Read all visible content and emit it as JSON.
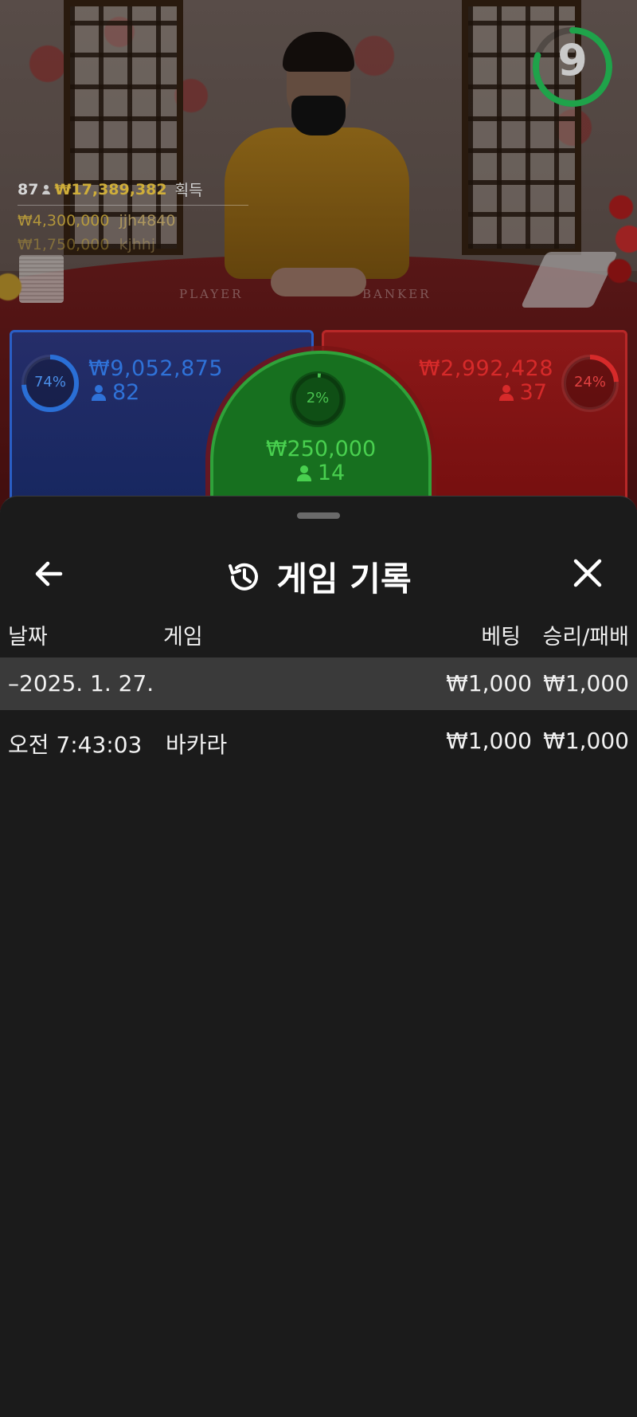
{
  "colors": {
    "player": "#2a6fd6",
    "banker": "#d62a2a",
    "tie": "#49c24f",
    "gold": "#cfae3a",
    "sheet_bg": "#1b1b1b",
    "row_highlight": "#3a3a3a"
  },
  "video": {
    "felt_player": "PLAYER",
    "felt_banker": "BANKER"
  },
  "timer": {
    "value": "9",
    "progress": 0.8
  },
  "winners": {
    "count": "87",
    "total": "₩17,389,382",
    "earned_label": "획득",
    "list": [
      {
        "amount": "₩4,300,000",
        "name": "jjh4840"
      },
      {
        "amount": "₩1,750,000",
        "name": "kjhhj"
      }
    ]
  },
  "bets": {
    "player": {
      "percent": 74,
      "percent_label": "74%",
      "amount": "₩9,052,875",
      "count": "82"
    },
    "tie": {
      "percent": 2,
      "percent_label": "2%",
      "amount": "₩250,000",
      "count": "14"
    },
    "banker": {
      "percent": 24,
      "percent_label": "24%",
      "amount": "₩2,992,428",
      "count": "37"
    }
  },
  "sheet": {
    "title": "게임 기록",
    "icons": {
      "back": "arrow-left-icon",
      "history": "history-icon",
      "close": "close-icon"
    },
    "columns": {
      "date": "날짜",
      "game": "게임",
      "bet": "베팅",
      "win_loss": "승리/패배"
    },
    "group": {
      "date": "–2025. 1. 27.",
      "bet": "₩1,000",
      "win_loss": "₩1,000"
    },
    "rows": [
      {
        "time": "오전 7:43:03",
        "game": "바카라",
        "bet": "₩1,000",
        "win_loss": "₩1,000"
      }
    ]
  }
}
